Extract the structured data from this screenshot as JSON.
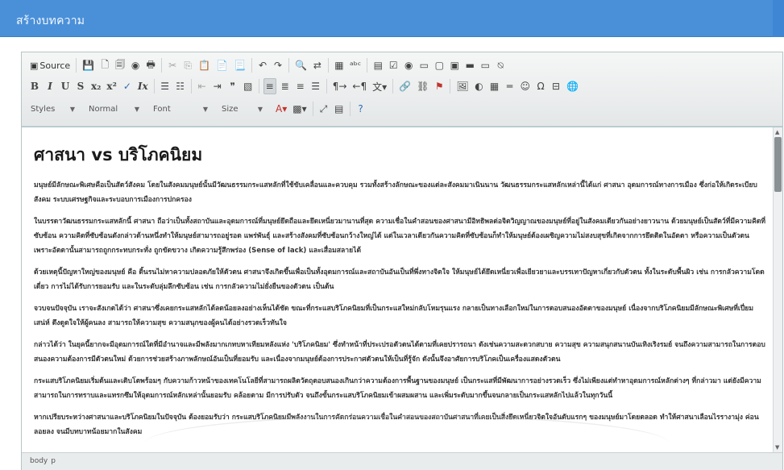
{
  "header": {
    "title": "สร้างบทความ"
  },
  "toolbar": {
    "row1": [
      {
        "name": "source-button",
        "label": "Source",
        "icon": "source-icon",
        "glyph": "▣"
      },
      {
        "sep": true
      },
      {
        "name": "save-button",
        "icon": "save-icon",
        "glyph": "💾"
      },
      {
        "name": "new-page-button",
        "icon": "new-page-icon",
        "glyph": "🗋"
      },
      {
        "name": "templates-button",
        "icon": "templates-icon",
        "glyph": "🗐"
      },
      {
        "name": "preview-button",
        "icon": "preview-icon",
        "glyph": "◉"
      },
      {
        "name": "print-button",
        "icon": "print-icon",
        "glyph": "🖶"
      },
      {
        "sep": true
      },
      {
        "name": "cut-button",
        "icon": "cut-icon",
        "glyph": "✂",
        "dim": true
      },
      {
        "name": "copy-button",
        "icon": "copy-icon",
        "glyph": "⎘",
        "dim": true
      },
      {
        "name": "paste-button",
        "icon": "paste-icon",
        "glyph": "📋"
      },
      {
        "name": "paste-text-button",
        "icon": "paste-text-icon",
        "glyph": "📄"
      },
      {
        "name": "paste-word-button",
        "icon": "paste-word-icon",
        "glyph": "📃"
      },
      {
        "sep": true
      },
      {
        "name": "undo-button",
        "icon": "undo-icon",
        "glyph": "↶"
      },
      {
        "name": "redo-button",
        "icon": "redo-icon",
        "glyph": "↷"
      },
      {
        "sep": true
      },
      {
        "name": "find-button",
        "icon": "find-icon",
        "glyph": "🔍"
      },
      {
        "name": "replace-button",
        "icon": "replace-icon",
        "glyph": "⇄"
      },
      {
        "sep": true
      },
      {
        "name": "select-all-button",
        "icon": "select-all-icon",
        "glyph": "▦"
      },
      {
        "name": "spellcheck-button",
        "icon": "spellcheck-icon",
        "glyph": "ᵃᵇᶜ"
      },
      {
        "sep": true
      },
      {
        "name": "form-button",
        "icon": "form-icon",
        "glyph": "▤"
      },
      {
        "name": "checkbox-button",
        "icon": "checkbox-icon",
        "glyph": "☑"
      },
      {
        "name": "radio-button",
        "icon": "radio-icon",
        "glyph": "◉"
      },
      {
        "name": "textfield-button",
        "icon": "textfield-icon",
        "glyph": "▭"
      },
      {
        "name": "textarea-button",
        "icon": "textarea-icon",
        "glyph": "▢"
      },
      {
        "name": "select-button",
        "icon": "select-icon",
        "glyph": "▣"
      },
      {
        "name": "button-button",
        "icon": "button-icon",
        "glyph": "▬"
      },
      {
        "name": "image-button-button",
        "icon": "image-button-icon",
        "glyph": "▭"
      },
      {
        "name": "hidden-field-button",
        "icon": "hidden-field-icon",
        "glyph": "⍉"
      }
    ],
    "row2": [
      {
        "name": "bold-button",
        "label": "B",
        "style": "bold"
      },
      {
        "name": "italic-button",
        "label": "I",
        "style": "ital"
      },
      {
        "name": "underline-button",
        "label": "U",
        "style": "bold"
      },
      {
        "name": "strike-button",
        "label": "S",
        "style": "bold"
      },
      {
        "name": "subscript-button",
        "label": "x₂",
        "style": "bold"
      },
      {
        "name": "superscript-button",
        "label": "x²",
        "style": "bold"
      },
      {
        "name": "remove-format-button",
        "icon": "remove-format-icon",
        "glyph": "✓",
        "cls": "blue"
      },
      {
        "name": "clear-format-button",
        "label": "Ix",
        "style": "ital"
      },
      {
        "sep": true
      },
      {
        "name": "numbered-list-button",
        "icon": "numbered-list-icon",
        "glyph": "☰"
      },
      {
        "name": "bulleted-list-button",
        "icon": "bulleted-list-icon",
        "glyph": "☷"
      },
      {
        "sep": true
      },
      {
        "name": "outdent-button",
        "icon": "outdent-icon",
        "glyph": "⇤",
        "dim": true
      },
      {
        "name": "indent-button",
        "icon": "indent-icon",
        "glyph": "⇥"
      },
      {
        "name": "blockquote-button",
        "icon": "blockquote-icon",
        "glyph": "❞"
      },
      {
        "name": "div-button",
        "icon": "div-icon",
        "glyph": "▧"
      },
      {
        "sep": true
      },
      {
        "name": "align-left-button",
        "icon": "align-left-icon",
        "glyph": "≡",
        "active": true
      },
      {
        "name": "align-center-button",
        "icon": "align-center-icon",
        "glyph": "≣"
      },
      {
        "name": "align-right-button",
        "icon": "align-right-icon",
        "glyph": "≡"
      },
      {
        "name": "justify-button",
        "icon": "justify-icon",
        "glyph": "☰"
      },
      {
        "sep": true
      },
      {
        "name": "ltr-button",
        "icon": "ltr-icon",
        "glyph": "¶→"
      },
      {
        "name": "rtl-button",
        "icon": "rtl-icon",
        "glyph": "←¶"
      },
      {
        "name": "language-button",
        "icon": "language-icon",
        "glyph": "文▾"
      },
      {
        "sep": true
      },
      {
        "name": "link-button",
        "icon": "link-icon",
        "glyph": "🔗"
      },
      {
        "name": "unlink-button",
        "icon": "unlink-icon",
        "glyph": "⛓"
      },
      {
        "name": "anchor-button",
        "icon": "anchor-icon",
        "glyph": "⚑",
        "cls": "red"
      },
      {
        "sep": true
      },
      {
        "name": "image-button",
        "icon": "image-icon",
        "glyph": "🖼"
      },
      {
        "name": "flash-button",
        "icon": "flash-icon",
        "glyph": "◐"
      },
      {
        "name": "table-button",
        "icon": "table-icon",
        "glyph": "▦"
      },
      {
        "name": "horizontal-line-button",
        "icon": "horizontal-line-icon",
        "glyph": "═"
      },
      {
        "name": "smiley-button",
        "icon": "smiley-icon",
        "glyph": "☺"
      },
      {
        "name": "special-char-button",
        "icon": "special-char-icon",
        "glyph": "Ω"
      },
      {
        "name": "page-break-button",
        "icon": "page-break-icon",
        "glyph": "⊟"
      },
      {
        "name": "iframe-button",
        "icon": "iframe-icon",
        "glyph": "🌐"
      }
    ],
    "row3": {
      "combos": [
        {
          "name": "styles-combo",
          "label": "Styles",
          "width": 62
        },
        {
          "name": "format-combo",
          "label": "Normal",
          "width": 70
        },
        {
          "name": "font-combo",
          "label": "Font",
          "width": 75
        },
        {
          "name": "size-combo",
          "label": "Size",
          "width": 58
        }
      ],
      "buttons": [
        {
          "name": "text-color-button",
          "icon": "text-color-icon",
          "glyph": "A▾",
          "cls": "red"
        },
        {
          "name": "bg-color-button",
          "icon": "bg-color-icon",
          "glyph": "▩▾"
        },
        {
          "sep": true
        },
        {
          "name": "maximize-button",
          "icon": "maximize-icon",
          "glyph": "⤢"
        },
        {
          "name": "show-blocks-button",
          "icon": "show-blocks-icon",
          "glyph": "▤"
        },
        {
          "sep": true
        },
        {
          "name": "about-button",
          "icon": "help-icon",
          "glyph": "?",
          "cls": "blue"
        }
      ]
    }
  },
  "document": {
    "title": "ศาสนา vs บริโภคนิยม",
    "paragraphs": [
      "มนุษย์มีลักษณะพิเศษคือเป็นสัตว์สังคม โดยในสังคมมนุษย์นั้นมีวัฒนธรรมกระแสหลักที่ใช้ขับเคลื่อนและควบคุม รวมทั้งสร้างลักษณะของแต่ละสังคมมาเนินนาน วัฒนธรรมกระแสหลักเหล่านี้ได้แก่ ศาสนา อุดมการณ์ทางการเมือง ซึ่งก่อให้เกิดระเบียบสังคม ระบบเศรษฐกิจและระบอบการเมืองการปกครอง",
      "ในบรรดาวัฒนธรรมกระแสหลักนี้ ศาสนา ถือว่าเป็นทั้งสถาบันและอุดมการณ์ที่มนุษย์ยึดถือและยึดเหนี่ยวมานานที่สุด ความเชื่อในคำสอนของศาสนามีอิทธิพลต่อจิตวิญญาณของมนุษย์ที่อยู่ในสังคมเดียวกันอย่างยาวนาน ด้วยมนุษย์เป็นสัตว์ที่มีความคิดที่ซับซ้อน ความคิดที่ซับซ้อนดังกล่าวด้านหนึ่งทำให้มนุษย์สามารถอยู่รอด แพร่พันธุ์ และสร้างสังคมที่ซับซ้อนกว้างใหญ่ได้ แต่ในเวลาเดียวกันความคิดที่ซับซ้อนก็ทำให้มนุษย์ต้องเผชิญความไม่สงบสุขที่เกิดจากการยึดติดในอัตตา หรือความเป็นตัวตน เพราะอัตตานั้นสามารถถูกกระทบกระทั่ง ถูกขัดขวาง เกิดความรู้สึกพร่อง (Sense of lack) และเสื่อมสลายได้",
      "ด้วยเหตุนี้ปัญหาใหญ่ของมนุษย์ คือ ดิ้นรนไม่หาความปลอดภัยให้ตัวตน ศาสนาจึงเกิดขึ้นเพื่อเป็นทั้งอุดมการณ์และสถาบันอันเป็นที่พึ่งทางจิตใจ ให้มนุษย์ได้ยึดเหนี่ยวเพื่อเยียวยาและบรรเทาปัญหาเกี่ยวกับตัวตน ทั้งในระดับพื้นผิว เช่น การกลัวความโดดเดี่ยว การไม่ได้รับการยอมรับ และในระดับลุ่มลึกซับซ้อน เช่น การกลัวความไม่ยั่งยืนของตัวตน เป็นต้น",
      "จวบจนปัจจุบัน เราจะสังเกตได้ว่า ศาสนาซึ่งเคยกระแสหลักได้ลดน้อยลงอย่างเห็นได้ชัด ขณะที่กระแสบริโภคนิยมที่เป็นกระแสใหม่กลับโหมรุนแรง กลายเป็นทางเลือกใหม่ในการตอบสนองอัตตาของมนุษย์ เนื่องจากบริโภคนิยมมีลักษณะพิเศษที่เปี่ยมเสน่ห์ ดึงดูดใจให้ผู้คนลง สามารถให้ความสุข ความสนุกของผู้คนได้อย่างรวดเร็วทันใจ",
      "กล่าวได้ว่า ในยุคนี้ยากจะมีอุดมการณ์ใดที่มีอำนาจและมีพลังมากเกทบหาเทียมหลังแห่ง 'บริโภคนิยม' ซึ่งทำหน้าที่ประเปรอตัวตนได้ตามที่เคยปรารถนา ดังเช่นความสะดวกสบาย ความสุข ความสนุกสนานบันเทิงเริงรมย์ จนถึงความสามารถในการตอบสนองความต้องการมีตัวตนใหม่ ด้วยการช่วยสร้างภาพลักษณ์อันเป็นที่ยอมรับ และเนื่องจากมนุษย์ต้องการประกาศตัวตนให้เป็นที่รู้จัก ดังนั้นจึงอาศัยการบริโภคเป็นเครื่องแสดงตัวตน",
      "กระแสบริโภคนิยมเริ่มต้นและเติบโตพร้อมๆ กับความก้าวหน้าของเทคโนโลยีที่สามารถผลิตวัตถุตอบสนองเกินกว่าความต้องการพื้นฐานของมนุษย์ เป็นกระแสที่มีพัฒนาการอย่างรวดเร็ว ซึ่งไม่เพียงแต่ทำหาอุดมการณ์หลักต่างๆ ที่กล่าวมา แต่ยังมีความสามารถในการทราบและแทรกซึมให้อุดมการณ์หลักเหล่านั้นยอมรับ คล้อยตาม มีการปรับตัว จนถึงขั้นกระแสบริโภคนิยมเข้าผสมผสาน และเพิ่มระดับมากขึ้นจนกลายเป็นกระแสหลักไปแล้วในทุกวันนี้",
      "หากเปรียบระหว่างศาสนาและบริโภคนิยมในปัจจุบัน ต้องยอมรับว่า กระแสบริโภคนิยมมีพลังงานในการคัดกร่อนความเชื่อในคำสอนของสถาบันศาสนาที่เคยเป็นสิ่งยึดเหนี่ยวจิตใจอันดับแรกๆ ของมนุษย์มาโดยตลอด ทำให้ศาสนาเลือนไรรางามุ่ง ค่อนลอยลง จนมีบทบาทน้อยมากในสังคม"
    ]
  },
  "statusbar": {
    "path": [
      "body",
      "p"
    ]
  }
}
